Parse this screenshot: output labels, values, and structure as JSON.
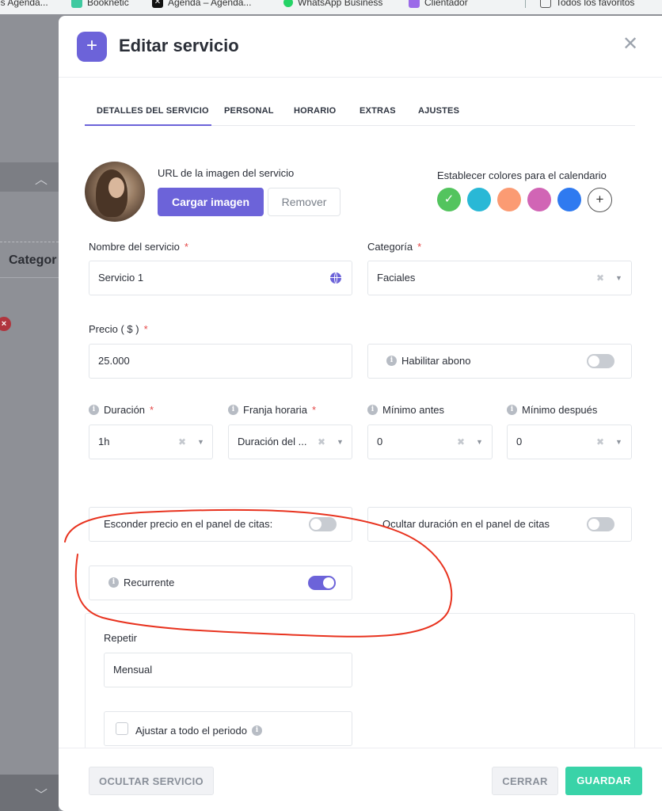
{
  "bookmarks": [
    {
      "label": "es Agenda...",
      "icon": "bookmark-icon"
    },
    {
      "label": "Booknetic",
      "icon": "booknetic-icon"
    },
    {
      "label": "Agenda – Agenda...",
      "icon": "x-icon"
    },
    {
      "label": "WhatsApp Business",
      "icon": "whatsapp-icon"
    },
    {
      "label": "Clientador",
      "icon": "clientador-icon"
    },
    {
      "label": "Todos los favoritos",
      "icon": "folder-icon"
    }
  ],
  "background": {
    "column_label": "Categor"
  },
  "modal": {
    "title": "Editar servicio",
    "tabs": [
      {
        "label": "DETALLES DEL SERVICIO",
        "active": true
      },
      {
        "label": "PERSONAL",
        "active": false
      },
      {
        "label": "HORARIO",
        "active": false
      },
      {
        "label": "EXTRAS",
        "active": false
      },
      {
        "label": "AJUSTES",
        "active": false
      }
    ],
    "image": {
      "label": "URL de la imagen del servicio",
      "upload_label": "Cargar imagen",
      "remove_label": "Remover"
    },
    "colors": {
      "label": "Establecer colores para el calendario",
      "swatches": [
        "#53c45e",
        "#29b8d6",
        "#fb9b73",
        "#d165b5",
        "#2f7af0"
      ],
      "selected_index": 0
    },
    "service_name": {
      "label": "Nombre del servicio",
      "value": "Servicio 1"
    },
    "category": {
      "label": "Categoría",
      "value": "Faciales"
    },
    "price": {
      "label": "Precio ( $ )",
      "value": "25.000"
    },
    "deposit": {
      "label": "Habilitar abono",
      "enabled": false
    },
    "duration": {
      "label": "Duración",
      "value": "1h"
    },
    "timeslot": {
      "label": "Franja horaria",
      "value": "Duración del ..."
    },
    "min_before": {
      "label": "Mínimo antes",
      "value": "0"
    },
    "min_after": {
      "label": "Mínimo después",
      "value": "0"
    },
    "hide_price": {
      "label": "Esconder precio en el panel de citas:",
      "enabled": false
    },
    "hide_duration": {
      "label": "Ocultar duración en el panel de citas",
      "enabled": false
    },
    "recurrent": {
      "label": "Recurrente",
      "enabled": true
    },
    "repeat": {
      "label": "Repetir",
      "value": "Mensual"
    },
    "fit_period": {
      "label": "Ajustar a todo el periodo",
      "checked": false
    },
    "required_mark": "*"
  },
  "footer": {
    "hide_service": "OCULTAR SERVICIO",
    "close": "CERRAR",
    "save": "GUARDAR"
  },
  "colors": {
    "accent": "#6c63d9",
    "save": "#39d3a8",
    "annotation": "#e8331f"
  }
}
